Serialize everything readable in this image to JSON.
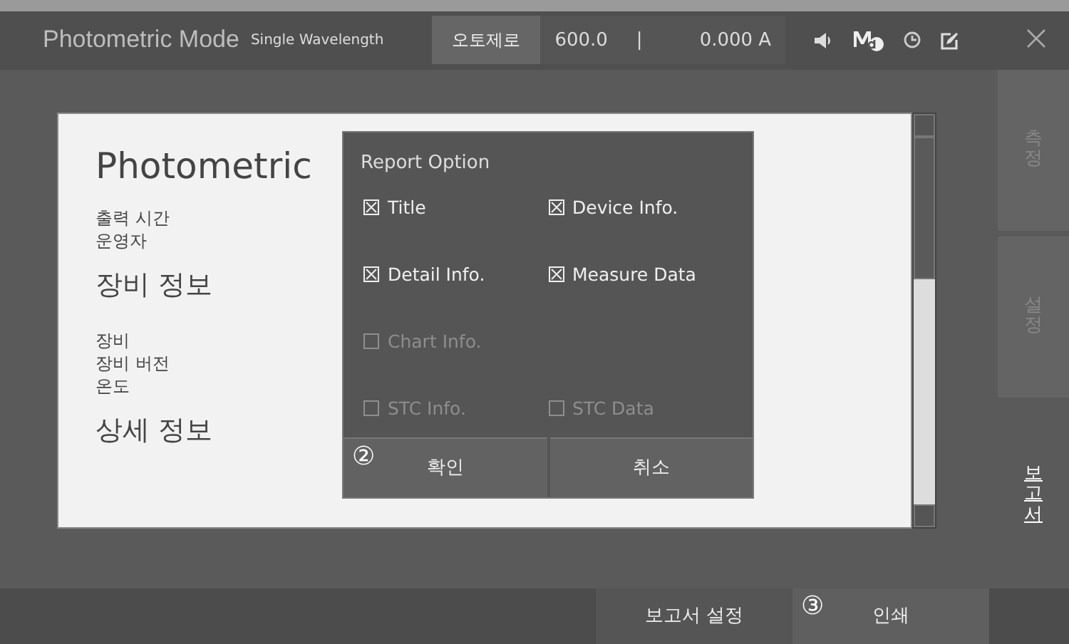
{
  "header": {
    "title": "Photometric Mode",
    "subtitle": "Single Wavelength",
    "autozero": "오토제로",
    "wavelength": "600.0",
    "separator": "|",
    "absorbance": "0.000 A"
  },
  "document": {
    "title": "Photometric",
    "sections": [
      {
        "lines": [
          "출력 시간",
          "운영자"
        ]
      },
      {
        "heading": "장비 정보",
        "lines": [
          "장비",
          "장비 버전",
          "온도"
        ]
      },
      {
        "heading": "상세 정보"
      }
    ]
  },
  "dialog": {
    "title": "Report Option",
    "rows": [
      [
        {
          "label": "Title",
          "checked": true,
          "disabled": false
        },
        {
          "label": "Device Info.",
          "checked": true,
          "disabled": false
        }
      ],
      [
        {
          "label": "Detail Info.",
          "checked": true,
          "disabled": false
        },
        {
          "label": "Measure Data",
          "checked": true,
          "disabled": false
        }
      ],
      [
        {
          "label": "Chart Info.",
          "checked": false,
          "disabled": true
        }
      ],
      [
        {
          "label": "STC Info.",
          "checked": false,
          "disabled": true
        },
        {
          "label": "STC Data",
          "checked": false,
          "disabled": true
        }
      ]
    ],
    "buttons": [
      {
        "label": "확인",
        "step": "②"
      },
      {
        "label": "취소"
      }
    ]
  },
  "side_tabs": [
    {
      "label": "측정",
      "selected": false
    },
    {
      "label": "설정",
      "selected": false
    },
    {
      "label": "보고서",
      "selected": true
    }
  ],
  "footer_buttons": [
    {
      "label": "보고서 설정"
    },
    {
      "label": "인쇄",
      "step": "③"
    }
  ]
}
